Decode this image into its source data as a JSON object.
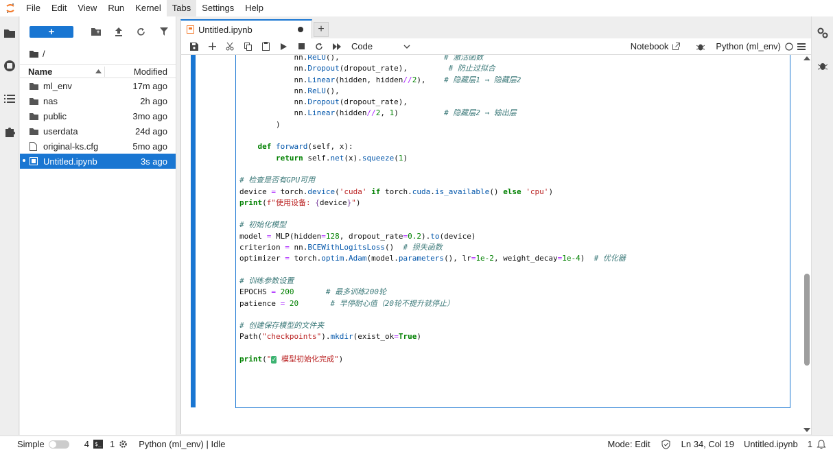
{
  "menubar": {
    "items": [
      "File",
      "Edit",
      "View",
      "Run",
      "Kernel",
      "Tabs",
      "Settings",
      "Help"
    ],
    "active": "Tabs"
  },
  "filebrowser": {
    "new_label": "+",
    "path": "/",
    "columns": {
      "name": "Name",
      "modified": "Modified"
    },
    "rows": [
      {
        "name": "ml_env",
        "modified": "17m ago",
        "type": "folder"
      },
      {
        "name": "nas",
        "modified": "2h ago",
        "type": "folder"
      },
      {
        "name": "public",
        "modified": "3mo ago",
        "type": "folder"
      },
      {
        "name": "userdata",
        "modified": "24d ago",
        "type": "folder"
      },
      {
        "name": "original-ks.cfg",
        "modified": "5mo ago",
        "type": "file"
      },
      {
        "name": "Untitled.ipynb",
        "modified": "3s ago",
        "type": "notebook",
        "selected": true
      }
    ]
  },
  "tab": {
    "label": "Untitled.ipynb",
    "add_label": "+"
  },
  "toolbar": {
    "cell_type": "Code",
    "notebook_label": "Notebook",
    "kernel_label": "Python (ml_env)"
  },
  "status": {
    "mode_label": "Simple",
    "count_terminals": "4",
    "terminal_icon_text": "$_",
    "count_kernels": "1",
    "kernel_status": "Python (ml_env) | Idle",
    "mode": "Mode: Edit",
    "position": "Ln 34, Col 19",
    "filename": "Untitled.ipynb",
    "notifications": "1"
  },
  "colors": {
    "accent": "#1976d2",
    "logo": "#f37726"
  }
}
